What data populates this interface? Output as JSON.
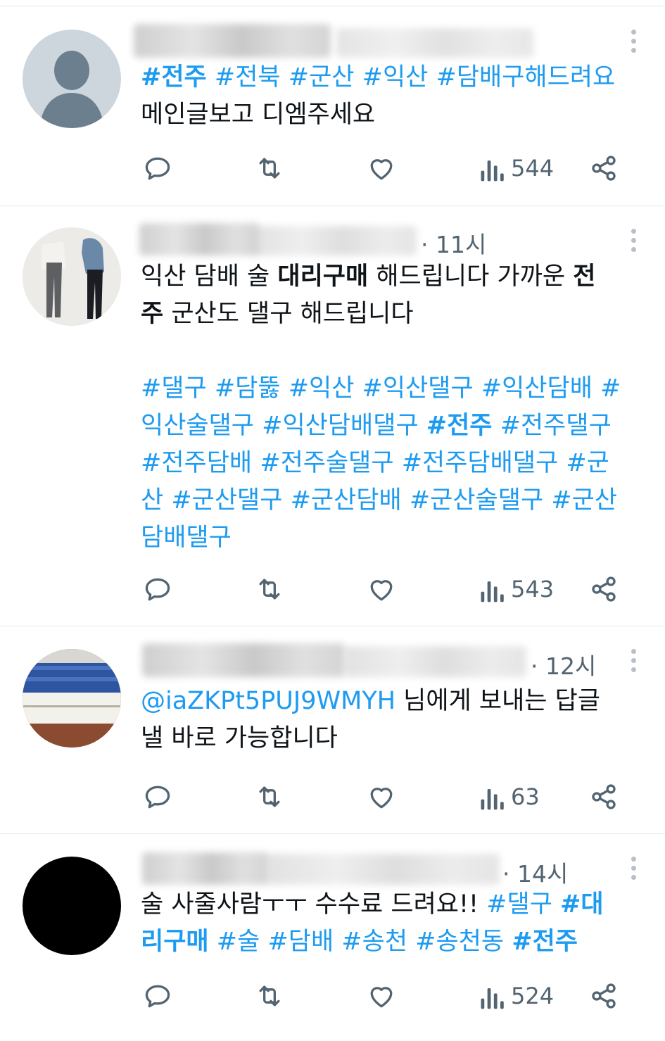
{
  "tweets": [
    {
      "time": "",
      "views": "544",
      "lines": [
        [
          {
            "t": "#전주",
            "c": "tag bold"
          },
          {
            "t": " "
          },
          {
            "t": "#전북",
            "c": "tag"
          },
          {
            "t": " "
          },
          {
            "t": "#군산",
            "c": "tag"
          },
          {
            "t": " "
          },
          {
            "t": "#익산",
            "c": "tag"
          },
          {
            "t": " "
          },
          {
            "t": "#담배구해드려요",
            "c": "tag"
          }
        ],
        [
          {
            "t": "메인글보고 디엠주세요"
          }
        ]
      ]
    },
    {
      "time": "· 11시",
      "views": "543",
      "lines": [
        [
          {
            "t": "익산 담배 술 "
          },
          {
            "t": "대리구매",
            "c": "bold"
          },
          {
            "t": " 해드립니다 가까운 "
          },
          {
            "t": "전",
            "c": "bold"
          }
        ],
        [
          {
            "t": "주",
            "c": "bold"
          },
          {
            "t": " 군산도 댈구 해드립니다"
          }
        ],
        [],
        [
          {
            "t": "#댈구 #담뚫 #익산 #익산댈구 #익산담배 #",
            "c": "tag"
          }
        ],
        [
          {
            "t": "익산술댈구 #익산담배댈구 ",
            "c": "tag"
          },
          {
            "t": "#전주",
            "c": "tag bold"
          },
          {
            "t": " #전주댈구",
            "c": "tag"
          }
        ],
        [
          {
            "t": "#전주담배 #전주술댈구 #전주담배댈구 #군",
            "c": "tag"
          }
        ],
        [
          {
            "t": "산 #군산댈구 #군산담배 #군산술댈구 #군산",
            "c": "tag"
          }
        ],
        [
          {
            "t": "담배댈구",
            "c": "tag"
          }
        ]
      ]
    },
    {
      "time": "· 12시",
      "views": "63",
      "lines": [
        [
          {
            "t": "@iaZKPt5PUJ9WMYH",
            "c": "tag"
          },
          {
            "t": " 님에게 보내는 답글"
          }
        ],
        [
          {
            "t": "낼 바로 가능합니다"
          }
        ]
      ]
    },
    {
      "time": "· 14시",
      "views": "524",
      "lines": [
        [
          {
            "t": "술 사줄사람ㅜㅜ 수수료 드려요!! "
          },
          {
            "t": "#댈구",
            "c": "tag"
          },
          {
            "t": " "
          },
          {
            "t": "#대",
            "c": "tag bold"
          }
        ],
        [
          {
            "t": "리구매",
            "c": "tag bold"
          },
          {
            "t": " "
          },
          {
            "t": "#술",
            "c": "tag"
          },
          {
            "t": " "
          },
          {
            "t": "#담배",
            "c": "tag"
          },
          {
            "t": " "
          },
          {
            "t": "#송천",
            "c": "tag"
          },
          {
            "t": " "
          },
          {
            "t": "#송천동",
            "c": "tag"
          },
          {
            "t": " "
          },
          {
            "t": "#전주",
            "c": "tag bold"
          }
        ]
      ]
    }
  ],
  "colors": {
    "link": "#1d9bf0",
    "muted": "#536471",
    "icon": "#536471",
    "divider": "#e6e9ec"
  },
  "icons": [
    "reply-icon",
    "retweet-icon",
    "like-icon",
    "views-icon",
    "share-icon",
    "more-icon"
  ]
}
